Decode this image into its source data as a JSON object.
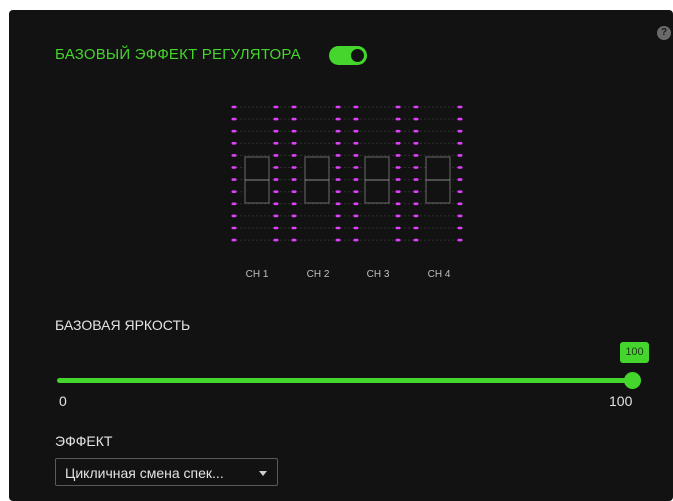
{
  "header": {
    "title": "БАЗОВЫЙ ЭФФЕКТ РЕГУЛЯТОРА",
    "toggle_on": true,
    "help_icon": "question-icon"
  },
  "fader_preview": {
    "channels": [
      "CH 1",
      "CH 2",
      "CH 3",
      "CH 4"
    ],
    "led_color": "#e040fb"
  },
  "brightness": {
    "label": "БАЗОВАЯ ЯРКОСТЬ",
    "value": "100",
    "min_label": "0",
    "max_label": "100",
    "fraction": 1.0
  },
  "effect": {
    "label": "ЭФФЕКТ",
    "selected": "Цикличная смена спек..."
  },
  "colors": {
    "accent": "#44d62c",
    "background": "#121212"
  }
}
